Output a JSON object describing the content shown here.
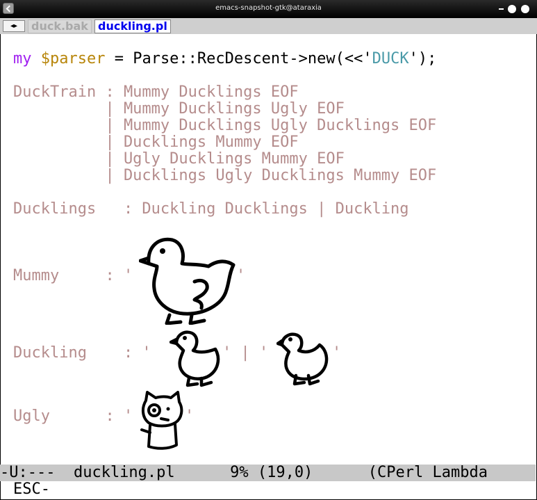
{
  "window": {
    "title": "emacs-snapshot-gtk@ataraxia"
  },
  "tabs": {
    "arrows": "◂▸",
    "items": [
      {
        "label": "duck.bak"
      },
      {
        "label": "duckling.pl"
      }
    ]
  },
  "code": {
    "line1": {
      "kw": "my",
      "var": "$parser",
      "mid": " = Parse::RecDescent->new(<<",
      "q1": "'",
      "str": "DUCK",
      "q2": "'",
      "end": ");"
    },
    "grammar": [
      "DuckTrain : Mummy Ducklings EOF",
      "          | Mummy Ducklings Ugly EOF",
      "          | Mummy Ducklings Ugly Ducklings EOF",
      "          | Ducklings Mummy EOF",
      "          | Ugly Ducklings Mummy EOF",
      "          | Ducklings Ugly Ducklings Mummy EOF",
      "Ducklings   : Duckling Ducklings | Duckling"
    ],
    "mummy": {
      "prefix": "Mummy     : '",
      "suffix": "'"
    },
    "duckling": {
      "prefix": "Duckling    : '",
      "mid": "' | '",
      "suffix": "'"
    },
    "ugly": {
      "prefix": "Ugly      : '",
      "suffix": "'"
    }
  },
  "modeline": {
    "text": "-U:---  duckling.pl      9% (19,0)      (CPerl Lambda"
  },
  "minibuffer": {
    "text": "ESC-"
  },
  "colors": {
    "keyword": "#a020f0",
    "variable": "#b8860b",
    "string": "#4a9aa8",
    "grammar": "#b58c8c",
    "tab_active": "#0000ee"
  }
}
